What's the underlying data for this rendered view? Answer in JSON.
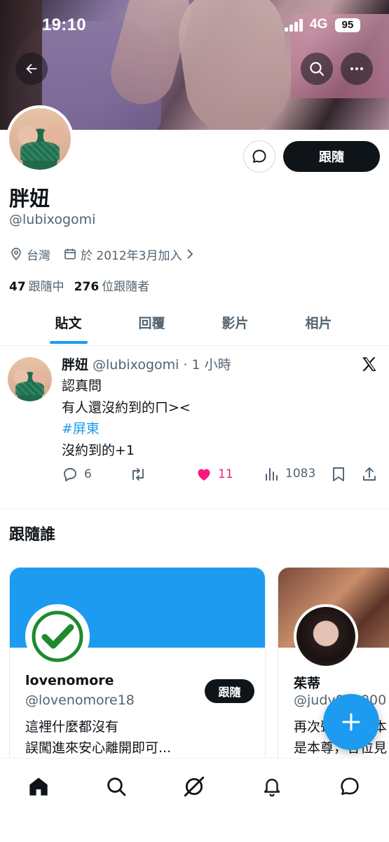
{
  "status": {
    "time": "19:10",
    "network": "4G",
    "battery": "95"
  },
  "profile": {
    "display_name": "胖妞",
    "handle": "@lubixogomi",
    "location": "台灣",
    "joined": "於 2012年3月加入",
    "following_count": "47",
    "following_label": "跟隨中",
    "followers_count": "276",
    "followers_label": "位跟隨者",
    "follow_button": "跟隨"
  },
  "tabs": [
    {
      "label": "貼文",
      "active": true
    },
    {
      "label": "回覆",
      "active": false
    },
    {
      "label": "影片",
      "active": false
    },
    {
      "label": "相片",
      "active": false
    }
  ],
  "post": {
    "name": "胖妞",
    "handle_time": "@lubixogomi · 1 小時",
    "lines": [
      "認真問",
      "有人還沒約到的ㄇ><",
      "#屏東",
      "沒約到的+1"
    ],
    "replies": "6",
    "likes": "11",
    "views": "1083"
  },
  "who_to_follow": {
    "title": "跟隨誰",
    "cards": [
      {
        "name": "lovenomore",
        "handle": "@lovenomore18",
        "bio": [
          "這裡什麼都沒有",
          "誤闖進來安心離開即可..."
        ],
        "follow_label": "跟隨"
      },
      {
        "name": "茱蒂",
        "handle": "@judy000000",
        "bio": [
          "再次聲明，是本",
          "是本尊，各位見"
        ]
      }
    ]
  },
  "colors": {
    "accent": "#1d9bf0",
    "like": "#f91880",
    "text": "#0f1419",
    "muted": "#536471"
  }
}
